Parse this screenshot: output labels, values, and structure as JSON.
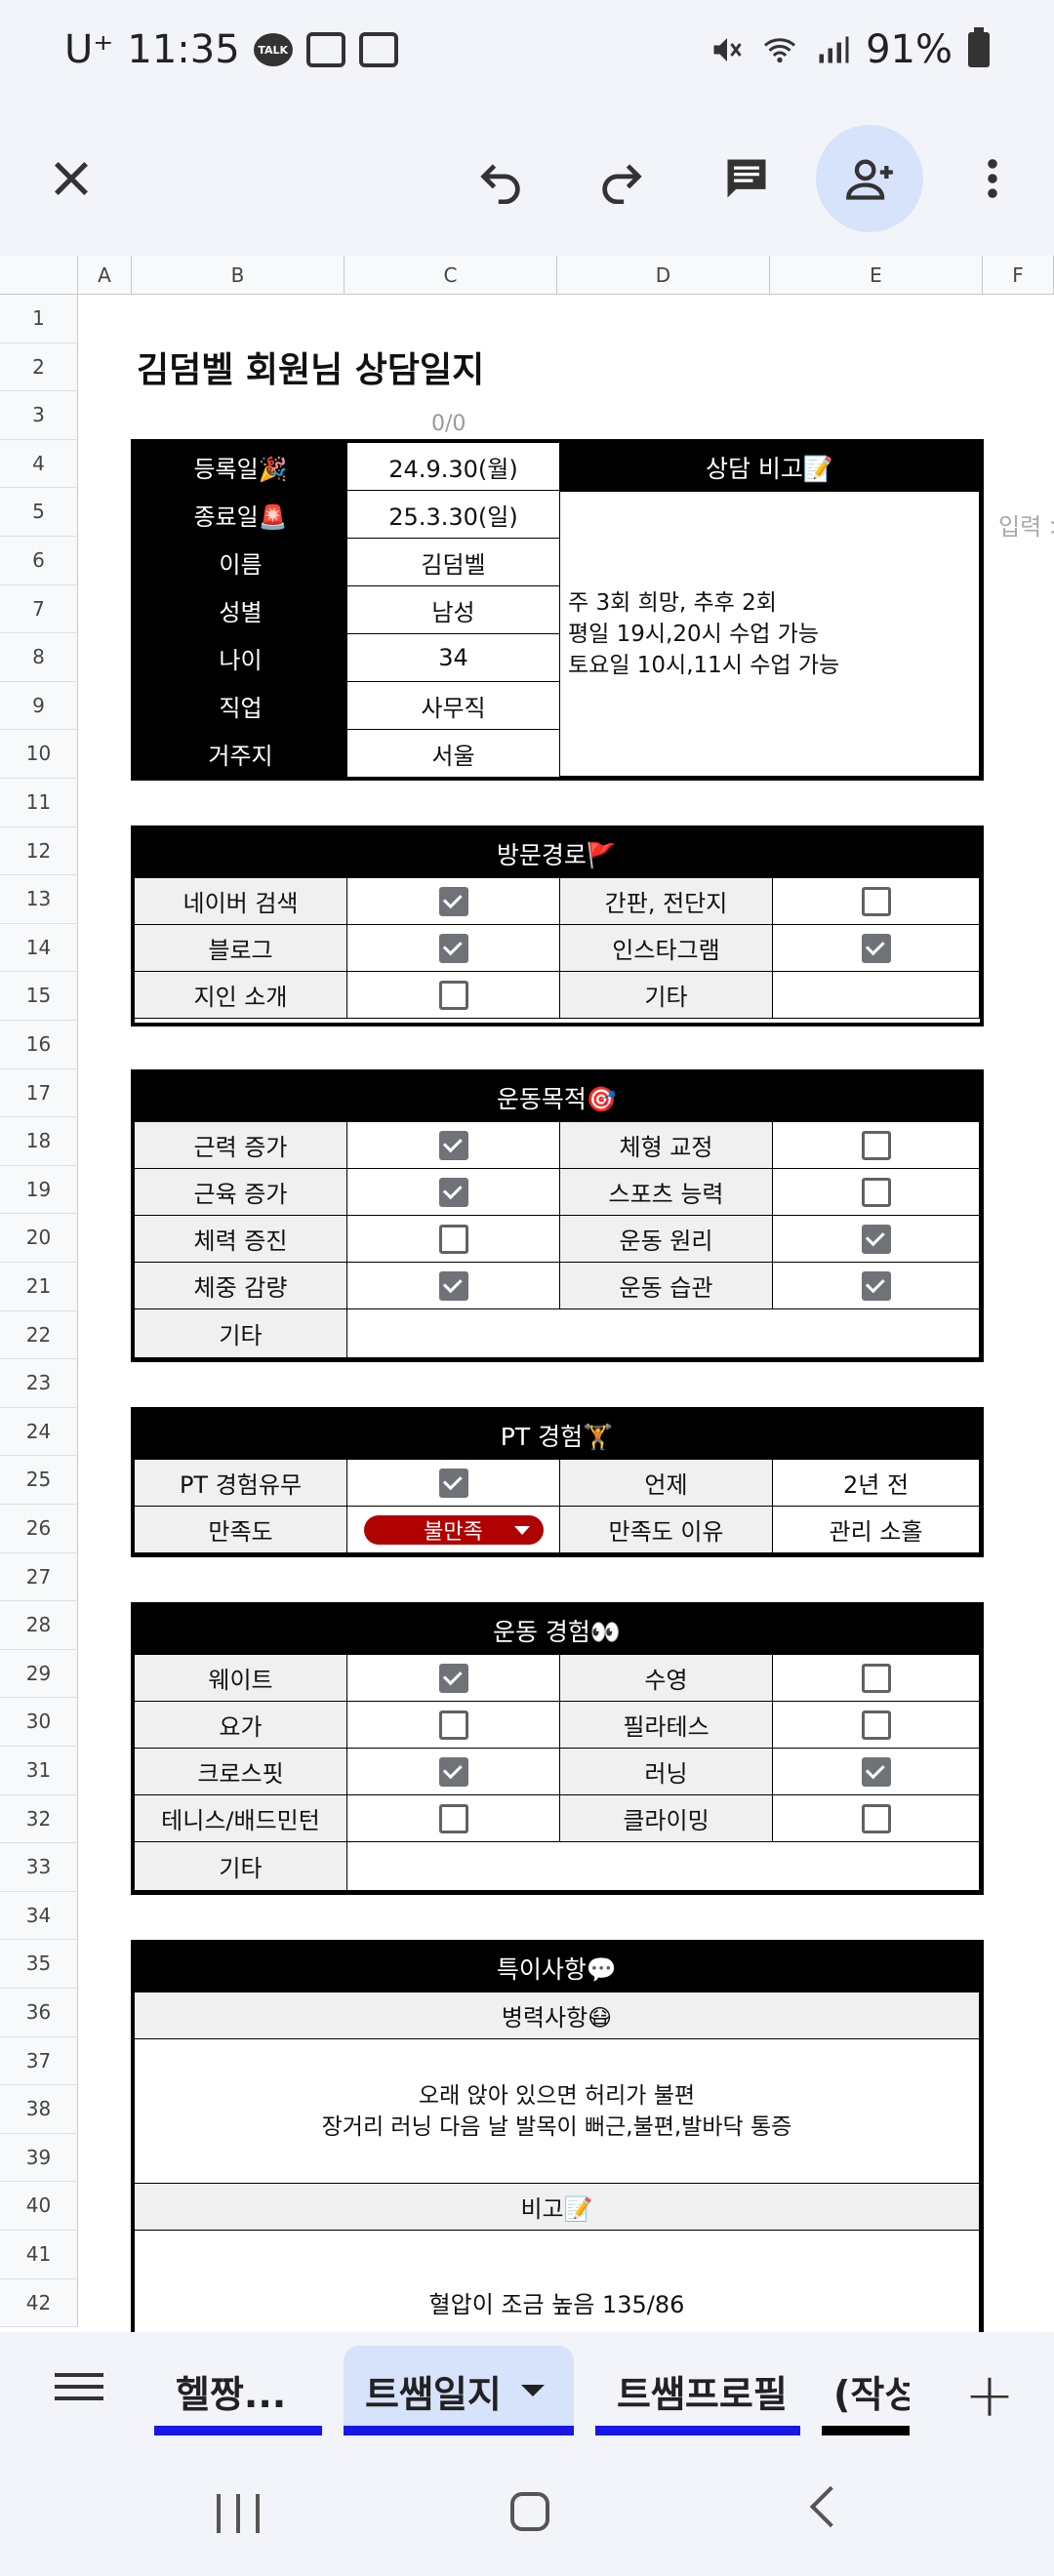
{
  "status_bar": {
    "carrier": "U⁺",
    "time": "11:35",
    "battery": "91%",
    "talk_icon": "TALK"
  },
  "toolbar": {
    "close_icon": "close-icon",
    "undo_icon": "undo-icon",
    "redo_icon": "redo-icon",
    "comment_icon": "comment-icon",
    "share_icon": "add-person-icon",
    "more_icon": "more-vert-icon"
  },
  "columns": [
    "A",
    "B",
    "C",
    "D",
    "E",
    "F"
  ],
  "rows": [
    "1",
    "2",
    "3",
    "4",
    "5",
    "6",
    "7",
    "8",
    "9",
    "10",
    "11",
    "12",
    "13",
    "14",
    "15",
    "16",
    "17",
    "18",
    "19",
    "20",
    "21",
    "22",
    "23",
    "24",
    "25",
    "26",
    "27",
    "28",
    "29",
    "30",
    "31",
    "32",
    "33",
    "34",
    "35",
    "36",
    "37",
    "38",
    "39",
    "40",
    "41",
    "42"
  ],
  "sheet": {
    "title": "김덤벨 회원님 상담일지",
    "counter": "0/0",
    "outside_hint": "입력 >",
    "info": {
      "rows": [
        {
          "label": "등록일🎉",
          "value": "24.9.30(월)"
        },
        {
          "label": "종료일🚨",
          "value": "25.3.30(일)"
        },
        {
          "label": "이름",
          "value": "김덤벨"
        },
        {
          "label": "성별",
          "value": "남성"
        },
        {
          "label": "나이",
          "value": "34"
        },
        {
          "label": "직업",
          "value": "사무직"
        },
        {
          "label": "거주지",
          "value": "서울"
        }
      ],
      "memo_header": "상담 비고📝",
      "memo": "주 3회 희망, 추후 2회\n평일 19시,20시 수업 가능\n토요일 10시,11시 수업 가능"
    },
    "visit": {
      "header": "방문경로🚩",
      "rows": [
        {
          "l1": "네이버 검색",
          "c1": true,
          "l2": "간판, 전단지",
          "c2": false
        },
        {
          "l1": "블로그",
          "c1": true,
          "l2": "인스타그램",
          "c2": true
        },
        {
          "l1": "지인 소개",
          "c1": false,
          "l2": "기타",
          "c2": null
        }
      ]
    },
    "goal": {
      "header": "운동목적🎯",
      "rows": [
        {
          "l1": "근력 증가",
          "c1": true,
          "l2": "체형 교정",
          "c2": false
        },
        {
          "l1": "근육 증가",
          "c1": true,
          "l2": "스포츠 능력",
          "c2": false
        },
        {
          "l1": "체력 증진",
          "c1": false,
          "l2": "운동 원리",
          "c2": true
        },
        {
          "l1": "체중 감량",
          "c1": true,
          "l2": "운동 습관",
          "c2": true
        }
      ],
      "etc_label": "기타"
    },
    "pt": {
      "header": "PT 경험🏋",
      "exp_label": "PT 경험유무",
      "exp_checked": true,
      "when_label": "언제",
      "when_value": "2년 전",
      "satisfaction_label": "만족도",
      "satisfaction_value": "불만족",
      "reason_label": "만족도 이유",
      "reason_value": "관리 소홀"
    },
    "exercise": {
      "header": "운동 경험👀",
      "rows": [
        {
          "l1": "웨이트",
          "c1": true,
          "l2": "수영",
          "c2": false
        },
        {
          "l1": "요가",
          "c1": false,
          "l2": "필라테스",
          "c2": false
        },
        {
          "l1": "크로스핏",
          "c1": true,
          "l2": "러닝",
          "c2": true
        },
        {
          "l1": "테니스/배드민턴",
          "c1": false,
          "l2": "클라이밍",
          "c2": false
        }
      ],
      "etc_label": "기타"
    },
    "special": {
      "header": "특이사항💬",
      "medical_header": "병력사항😷",
      "medical_text": "오래 앉아 있으면 허리가 불편\n장거리 러닝 다음 날 발목이 뻐근,불편,발바닥 통증",
      "note_header": "비고📝",
      "note_text": "혈압이 조금 높음 135/86"
    }
  },
  "sheet_tabs": [
    {
      "label": "헬짱...",
      "active": false,
      "color": "#1717e6"
    },
    {
      "label": "트쌤일지",
      "active": true,
      "color": "#1717e6"
    },
    {
      "label": "트쌤프로필",
      "active": false,
      "color": "#1717e6"
    },
    {
      "label": "(작성",
      "active": false,
      "color": "#000000"
    }
  ],
  "colors": {
    "header_black": "#000000",
    "chip_red": "#b10202",
    "tab_underline": "#1717e6",
    "active_tab_bg": "#d7e2fb"
  }
}
